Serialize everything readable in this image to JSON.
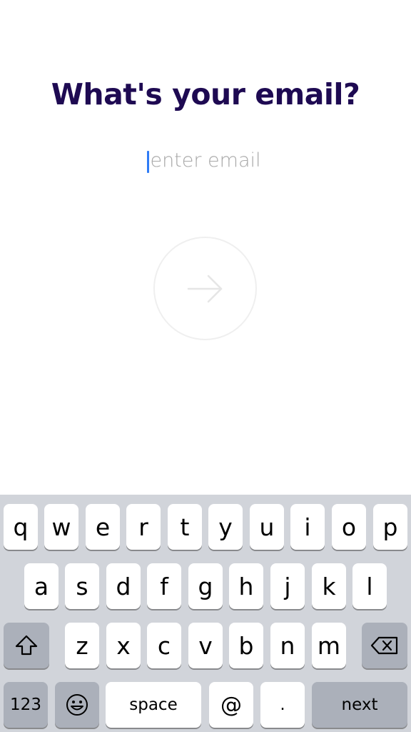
{
  "page": {
    "title": "What's your email?",
    "email_placeholder": "enter email",
    "email_value": ""
  },
  "next_button": {
    "icon": "arrow-right-icon"
  },
  "keyboard": {
    "row1": [
      "q",
      "w",
      "e",
      "r",
      "t",
      "y",
      "u",
      "i",
      "o",
      "p"
    ],
    "row2": [
      "a",
      "s",
      "d",
      "f",
      "g",
      "h",
      "j",
      "k",
      "l"
    ],
    "row3": [
      "z",
      "x",
      "c",
      "v",
      "b",
      "n",
      "m"
    ],
    "numbers_label": "123",
    "space_label": "space",
    "at_label": "@",
    "dot_label": ".",
    "next_label": "next",
    "shift_icon": "shift-icon",
    "backspace_icon": "backspace-icon",
    "emoji_icon": "emoji-icon"
  }
}
